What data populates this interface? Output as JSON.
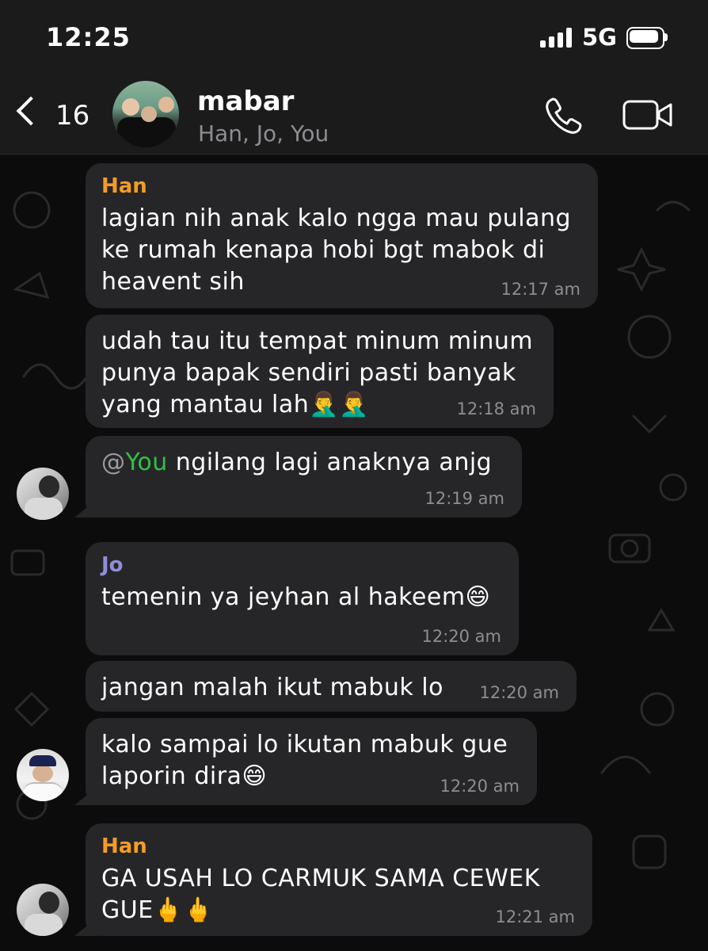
{
  "status_bar": {
    "time": "12:25",
    "network": "5G"
  },
  "header": {
    "back_count": "16",
    "chat_name": "mabar",
    "members": "Han, Jo, You",
    "icons": {
      "back": "chevron-left-icon",
      "call": "phone-icon",
      "video": "video-camera-icon"
    }
  },
  "colors": {
    "background": "#0c0c0c",
    "bubble": "#262628",
    "han_name": "#f59c26",
    "jo_name": "#8e8fd6",
    "mention": "#30c248",
    "timestamp": "#8d8d92"
  },
  "messages": [
    {
      "sender": "Han",
      "text": "lagian nih anak kalo ngga mau pulang ke rumah kenapa hobi bgt mabok di heavent sih",
      "time": "12:17 am"
    },
    {
      "text": "udah tau itu tempat minum minum punya bapak sendiri pasti banyak yang mantau lah🤦‍♂️🤦‍♂️",
      "time": "12:18 am"
    },
    {
      "mention_at": "@",
      "mention_name": "You",
      "text": " ngilang lagi anaknya anjg",
      "time": "12:19 am"
    },
    {
      "sender": "Jo",
      "text": "temenin ya jeyhan al hakeem😄",
      "time": "12:20 am"
    },
    {
      "text": "jangan malah ikut mabuk lo",
      "time": "12:20 am"
    },
    {
      "text": "kalo sampai lo ikutan mabuk gue laporin dira😄",
      "time": "12:20 am"
    },
    {
      "sender": "Han",
      "text": "GA USAH LO CARMUK SAMA CEWEK GUE🖕🖕",
      "time": "12:21 am"
    }
  ]
}
